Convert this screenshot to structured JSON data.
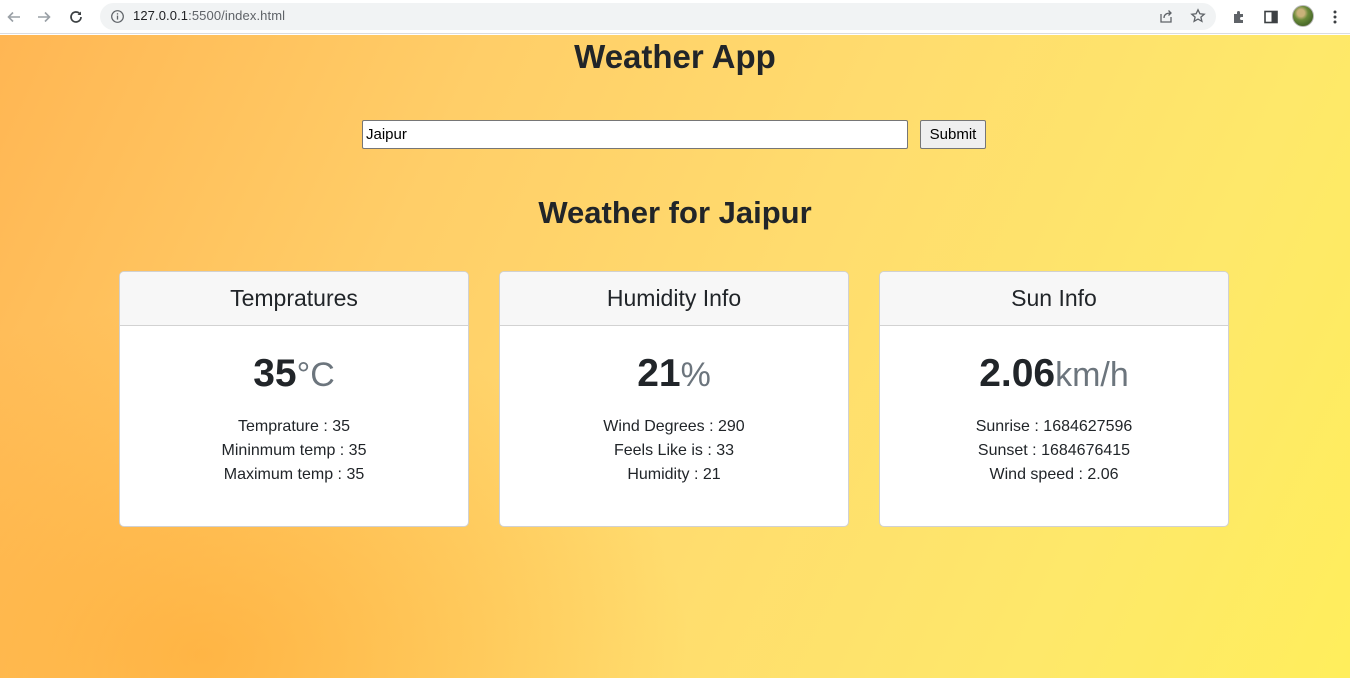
{
  "browser": {
    "url_host": "127.0.0.1",
    "url_path": ":5500/index.html"
  },
  "app": {
    "title": "Weather App",
    "search": {
      "value": "Jaipur",
      "submit_label": "Submit"
    },
    "heading": "Weather for Jaipur"
  },
  "cards": [
    {
      "title": "Tempratures",
      "value": "35",
      "unit": "°C",
      "lines": [
        "Temprature : 35",
        "Mininmum temp : 35",
        "Maximum temp : 35"
      ]
    },
    {
      "title": "Humidity Info",
      "value": "21",
      "unit": "%",
      "lines": [
        "Wind Degrees : 290",
        "Feels Like is : 33",
        "Humidity : 21"
      ]
    },
    {
      "title": "Sun Info",
      "value": "2.06",
      "unit": "km/h",
      "lines": [
        "Sunrise : 1684627596",
        "Sunset : 1684676415",
        "Wind speed : 2.06"
      ]
    }
  ]
}
